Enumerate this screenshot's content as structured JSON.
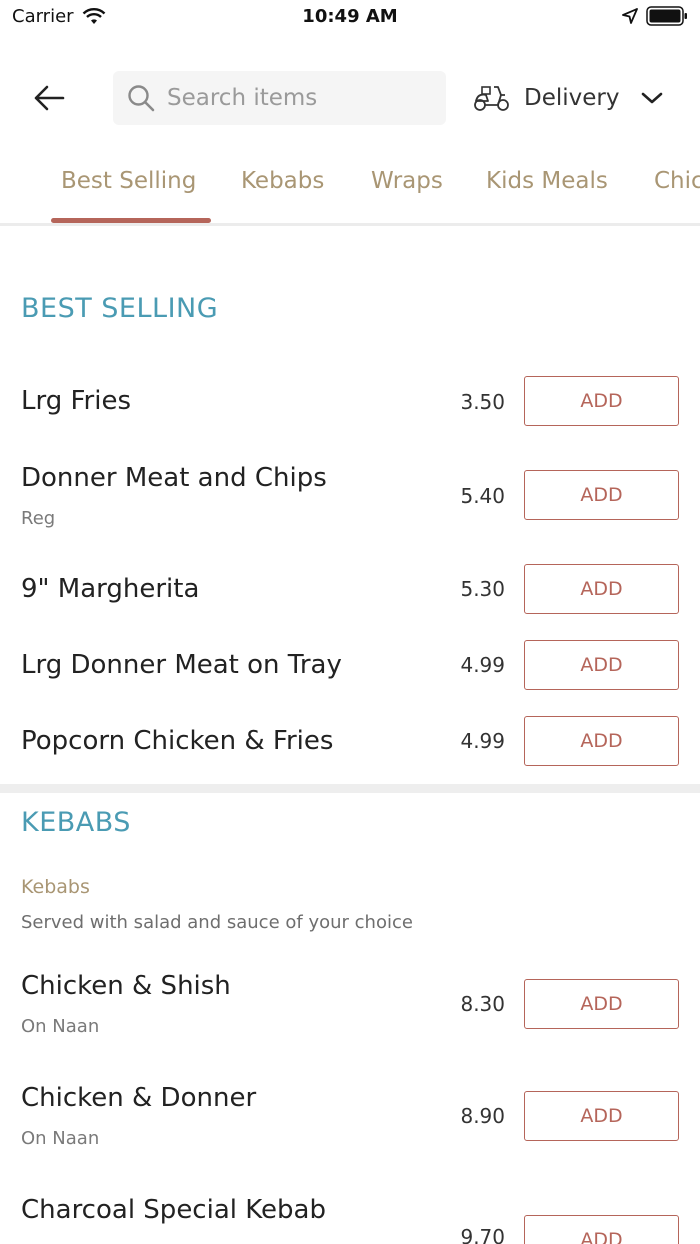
{
  "status_bar": {
    "carrier": "Carrier",
    "time": "10:49 AM"
  },
  "header": {
    "search_placeholder": "Search items",
    "delivery_label": "Delivery"
  },
  "tabs": [
    {
      "label": "Best Selling",
      "active": true
    },
    {
      "label": "Kebabs",
      "active": false
    },
    {
      "label": "Wraps",
      "active": false
    },
    {
      "label": "Kids Meals",
      "active": false
    },
    {
      "label": "Chic",
      "active": false
    }
  ],
  "sections": [
    {
      "title": "BEST SELLING",
      "items": [
        {
          "name": "Lrg Fries",
          "sub": "",
          "price": "3.50",
          "add_label": "ADD"
        },
        {
          "name": "Donner Meat and Chips",
          "sub": "Reg",
          "price": "5.40",
          "add_label": "ADD"
        },
        {
          "name": "9\" Margherita",
          "sub": "",
          "price": "5.30",
          "add_label": "ADD"
        },
        {
          "name": "Lrg Donner Meat on Tray",
          "sub": "",
          "price": "4.99",
          "add_label": "ADD"
        },
        {
          "name": "Popcorn Chicken & Fries",
          "sub": "",
          "price": "4.99",
          "add_label": "ADD"
        }
      ]
    },
    {
      "title": "KEBABS",
      "category_name": "Kebabs",
      "category_desc": "Served with salad and sauce of your choice",
      "items": [
        {
          "name": "Chicken & Shish",
          "sub": "On Naan",
          "price": "8.30",
          "add_label": "ADD"
        },
        {
          "name": "Chicken & Donner",
          "sub": "On Naan",
          "price": "8.90",
          "add_label": "ADD"
        },
        {
          "name": "Charcoal Special Kebab",
          "sub": "",
          "price": "9.70",
          "add_label": "ADD"
        }
      ]
    }
  ]
}
